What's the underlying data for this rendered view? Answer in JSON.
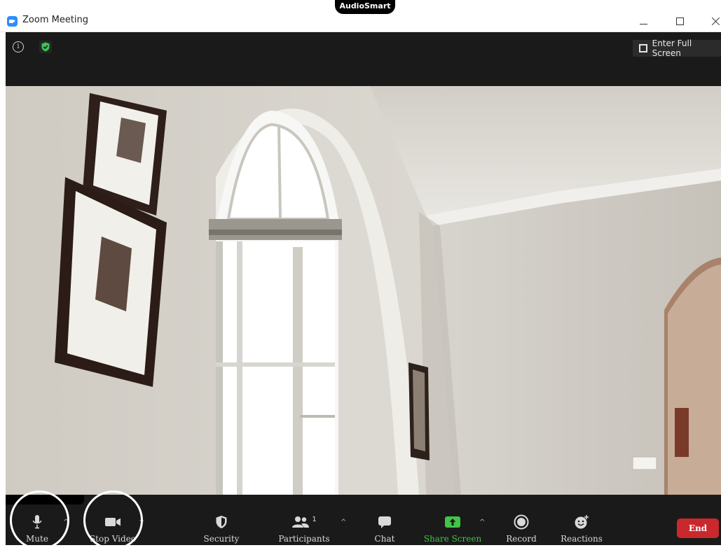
{
  "window": {
    "title": "Zoom Meeting",
    "overlay_label": "AudioSmart",
    "controls": [
      "minimize",
      "maximize",
      "close"
    ]
  },
  "topbar": {
    "info_icon": "info-icon",
    "security_icon": "shield-check-icon",
    "fullscreen_label": "Enter Full Screen"
  },
  "toolbar": {
    "mute_label": "Mute",
    "stop_video_label": "Stop Video",
    "security_label": "Security",
    "participants_label": "Participants",
    "participants_count": "1",
    "chat_label": "Chat",
    "share_screen_label": "Share Screen",
    "record_label": "Record",
    "reactions_label": "Reactions",
    "end_label": "End"
  },
  "colors": {
    "zoom_blue": "#2D8CFF",
    "share_green": "#41C447",
    "end_red": "#C9282D",
    "bar_bg": "#1A1A1A"
  }
}
